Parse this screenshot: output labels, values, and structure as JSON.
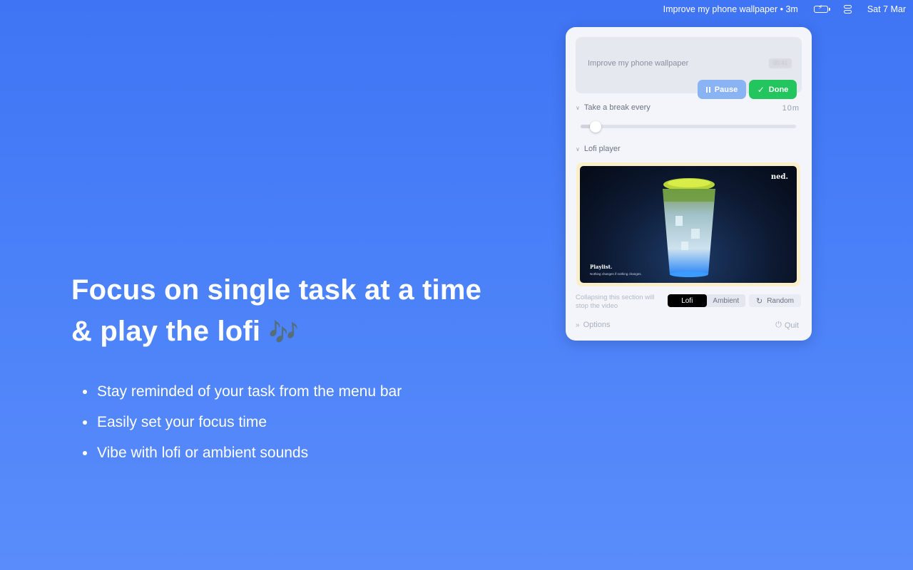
{
  "menubar": {
    "task_status": "Improve my phone wallpaper • 3m",
    "date": "Sat 7 Mar",
    "battery_icon": "battery-charging-icon",
    "control_icon": "control-center-icon"
  },
  "hero": {
    "line1": "Focus on single task at a time",
    "line2": "& play the lofi",
    "note_glyph": "🎶",
    "bullets": [
      "Stay reminded of your task from the menu bar",
      "Easily set your focus time",
      "Vibe with lofi or ambient sounds"
    ]
  },
  "panel": {
    "task": {
      "title": "Improve my phone wallpaper",
      "badge": "00:41",
      "pause_label": "Pause",
      "done_label": "Done"
    },
    "break_section": {
      "label": "Take a break every",
      "value": "10m",
      "slider_level": 0.07
    },
    "lofi_section": {
      "label": "Lofi player",
      "video_brand": "ned.",
      "video_caption": "Playlist.",
      "video_sub": "Nothing changes if nothing changes."
    },
    "collapse_note": "Collapsing this section will stop the video",
    "modes": [
      "Lofi",
      "Ambient"
    ],
    "active_mode": "Lofi",
    "random_label": "Random",
    "options_label": "Options",
    "quit_label": "Quit"
  },
  "colors": {
    "background": "#4a80f8",
    "done": "#22c55e",
    "pause": "#8ab3f3"
  }
}
